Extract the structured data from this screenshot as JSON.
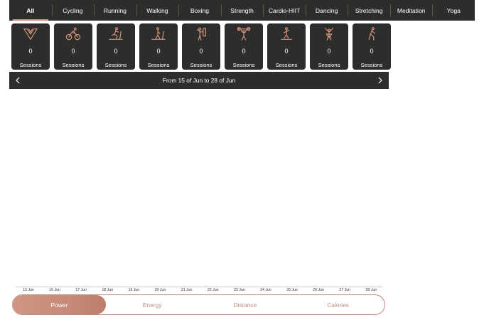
{
  "tabs": [
    {
      "label": "All",
      "active": true
    },
    {
      "label": "Cycling"
    },
    {
      "label": "Running"
    },
    {
      "label": "Walking"
    },
    {
      "label": "Boxing"
    },
    {
      "label": "Strength"
    },
    {
      "label": "Cardio-HIIT"
    },
    {
      "label": "Dancing"
    },
    {
      "label": "Stretching"
    },
    {
      "label": "Meditation"
    },
    {
      "label": "Yoga"
    }
  ],
  "cards": [
    {
      "icon": "all-icon",
      "count": "0",
      "label": "Sessions"
    },
    {
      "icon": "cycling-icon",
      "count": "0",
      "label": "Sessions"
    },
    {
      "icon": "treadmill-running-icon",
      "count": "0",
      "label": "Sessions"
    },
    {
      "icon": "treadmill-walking-icon",
      "count": "0",
      "label": "Sessions"
    },
    {
      "icon": "boxing-icon",
      "count": "0",
      "label": "Sessions"
    },
    {
      "icon": "weightlifting-icon",
      "count": "0",
      "label": "Sessions"
    },
    {
      "icon": "hiit-icon",
      "count": "0",
      "label": "Sessions"
    },
    {
      "icon": "dancing-icon",
      "count": "0",
      "label": "Sessions"
    },
    {
      "icon": "stretching-icon",
      "count": "0",
      "label": "Sessions"
    }
  ],
  "range": {
    "text": "From 15 of Jun to 28 of Jun"
  },
  "axis_ticks": [
    "15 Jun",
    "16 Jun",
    "17 Jun",
    "18 Jun",
    "19 Jun",
    "20 Jun",
    "21 Jun",
    "22 Jun",
    "23 Jun",
    "24 Jun",
    "25 Jun",
    "26 Jun",
    "27 Jun",
    "28 Jun"
  ],
  "metrics": [
    {
      "label": "Power",
      "active": true
    },
    {
      "label": "Energy"
    },
    {
      "label": "Distance"
    },
    {
      "label": "Calories"
    }
  ],
  "colors": {
    "accent": "#c98b78",
    "dark": "#2d2e2b",
    "icon_stroke": "#d4917c"
  }
}
